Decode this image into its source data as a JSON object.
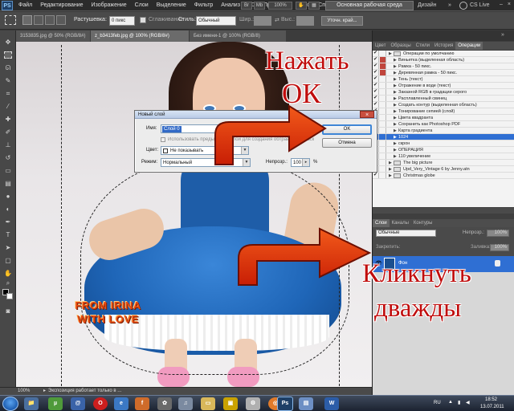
{
  "app": {
    "logo": "PS",
    "menus": [
      "Файл",
      "Редактирование",
      "Изображение",
      "Слои",
      "Выделение",
      "Фильтр",
      "Анализ",
      "3D",
      "Просмотр",
      "Окно",
      "Справка"
    ],
    "zoom": "100%",
    "workspace": "Основная рабочая среда",
    "design": "Дизайн",
    "cslive": "CS Live"
  },
  "options": {
    "feather_label": "Растушевка:",
    "feather_value": "0 пикс",
    "smooth_label": "Сглаживание",
    "style_label": "Стиль:",
    "style_value": "Обычный",
    "width_label": "Шир.:",
    "height_label": "Выс.:",
    "refine_btn": "Уточн. край..."
  },
  "doc_tabs": [
    "3153835.jpg @ 50% (RGB/8#)",
    "z_b3413feb.jpg @ 100% (RGB/8#)",
    "Без имени-1 @ 100% (RGB/8)"
  ],
  "canvas": {
    "watermark_line1": "FROM IRINA",
    "watermark_line2": "WITH LOVE"
  },
  "status": {
    "zoom": "100%",
    "message": "Экспозиция работает только в ..."
  },
  "panel_tabs": [
    "Цвет",
    "Образцы",
    "Стили",
    "История",
    "Операции"
  ],
  "actions": [
    {
      "label": "Операции по умолчанию",
      "check": "✔",
      "red": false,
      "folder": true
    },
    {
      "label": "Виньетка (выделенная область)",
      "check": "✔",
      "red": true
    },
    {
      "label": "Рамка - 50 пикс.",
      "check": "✔",
      "red": true
    },
    {
      "label": "Деревянная рамка - 50 пикс.",
      "check": "✔",
      "red": true
    },
    {
      "label": "Тень (текст)",
      "check": "✔",
      "red": false
    },
    {
      "label": "Отражение в воде (текст)",
      "check": "✔",
      "red": false
    },
    {
      "label": "Заказной RGB в градации серого",
      "check": "✔",
      "red": false
    },
    {
      "label": "Расплавленный свинец",
      "check": "✔",
      "red": false
    },
    {
      "label": "Создать контур (выделенная область)",
      "check": "✔",
      "red": false
    },
    {
      "label": "Тонирование сепией (слой)",
      "check": "✔",
      "red": false
    },
    {
      "label": "Цвета квадранта",
      "check": "✔",
      "red": false
    },
    {
      "label": "Сохранить как Photoshop PDF",
      "check": "✔",
      "red": false
    },
    {
      "label": "Карта градиента",
      "check": "✔",
      "red": false
    },
    {
      "label": "1024",
      "check": "✔",
      "red": false,
      "selected": true
    },
    {
      "label": "скрон",
      "check": "✔",
      "red": false
    },
    {
      "label": "ОПЕРАЦИЯ",
      "check": "✔",
      "red": false
    },
    {
      "label": "110 увеличение",
      "check": "✔",
      "red": false
    },
    {
      "label": "The big picture",
      "check": "✔",
      "red": false,
      "folder": true
    },
    {
      "label": "Upd_Very_Vintage 6 by Jenny.atn",
      "check": "✔",
      "red": false,
      "folder": true
    },
    {
      "label": "Christmas globe",
      "check": "✔",
      "red": false,
      "folder": true
    }
  ],
  "layers": {
    "tabs": [
      "Слои",
      "Каналы",
      "Контуры"
    ],
    "blend_mode": "Обычные",
    "opacity_label": "Непрозр.:",
    "opacity_value": "100%",
    "lock_label": "Закрепить:",
    "fill_label": "Заливка:",
    "fill_value": "100%",
    "layer_name": "Фон"
  },
  "dialog": {
    "title": "Новый слой",
    "name_label": "Имя:",
    "name_value": "Слой 0",
    "use_prev_label": "Использовать предыдущий слой для создания обтравочной маски",
    "color_label": "Цвет:",
    "color_value": "Не показывать",
    "mode_label": "Режим:",
    "mode_value": "Нормальный",
    "opacity_label": "Непрозр.:",
    "opacity_value": "100",
    "opacity_unit": "%",
    "ok": "OK",
    "cancel": "Отмена"
  },
  "annotations": {
    "top_line1": "Нажать",
    "top_line2": "ОК",
    "bottom_line1": "Кликнуть",
    "bottom_line2": "дважды",
    "color": "#c00d0d"
  },
  "taskbar": {
    "lang": "RU",
    "time": "18:52",
    "date": "13.07.2011"
  }
}
